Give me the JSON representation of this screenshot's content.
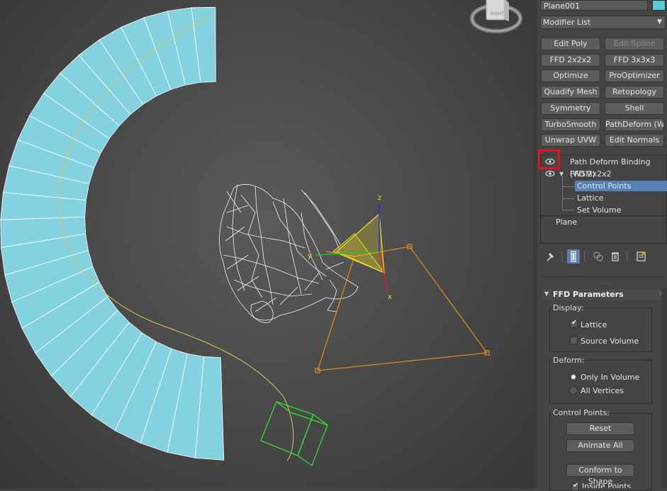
{
  "viewcube": {
    "label": "RIGHT"
  },
  "axes": {
    "x": "x",
    "y": "y",
    "z": "z"
  },
  "object": {
    "name": "Plane001",
    "color": "#5fc8d8"
  },
  "modifier_list": {
    "label": "Modifier List"
  },
  "modifier_buttons": [
    {
      "label": "Edit Poly",
      "enabled": true
    },
    {
      "label": "Edit Spline",
      "enabled": false
    },
    {
      "label": "FFD 2x2x2",
      "enabled": true
    },
    {
      "label": "FFD 3x3x3",
      "enabled": true
    },
    {
      "label": "Optimize",
      "enabled": true
    },
    {
      "label": "ProOptimizer",
      "enabled": true
    },
    {
      "label": "Quadify Mesh",
      "enabled": true
    },
    {
      "label": "Retopology",
      "enabled": true
    },
    {
      "label": "Symmetry",
      "enabled": true
    },
    {
      "label": "Shell",
      "enabled": true
    },
    {
      "label": "TurboSmooth",
      "enabled": true
    },
    {
      "label": "PathDeform (WSM)",
      "enabled": true
    },
    {
      "label": "Unwrap UVW",
      "enabled": true
    },
    {
      "label": "Edit Normals",
      "enabled": true
    }
  ],
  "stack": {
    "wsm": "Path Deform Binding (WSM)",
    "ffd": "FFD 2x2x2",
    "sub": [
      "Control Points",
      "Lattice",
      "Set Volume"
    ],
    "selected_sub": "Control Points",
    "base": "Plane"
  },
  "toolbar": {
    "icons": [
      "pin-stack-icon",
      "show-end-result-icon",
      "make-unique-icon",
      "remove-modifier-icon",
      "configure-sets-icon"
    ]
  },
  "ffd_params": {
    "title": "FFD Parameters",
    "display": {
      "label": "Display:",
      "lattice": "Lattice",
      "lattice_checked": true,
      "source_volume": "Source Volume",
      "source_volume_checked": false
    },
    "deform": {
      "label": "Deform:",
      "only_in_volume": "Only In Volume",
      "all_vertices": "All Vertices",
      "selected": "Only In Volume"
    },
    "control_points": {
      "label": "Control Points:",
      "reset": "Reset",
      "animate_all": "Animate All",
      "conform": "Conform to Shape",
      "inside_points": "Inside Points",
      "inside_points_checked": true
    }
  },
  "colors": {
    "mesh": "#84d2e0",
    "lattice": "#e08a1e",
    "gizmo": "#f0e020",
    "helper": "#30e030",
    "highlight": "#e0141e",
    "selection": "#5680b8"
  }
}
